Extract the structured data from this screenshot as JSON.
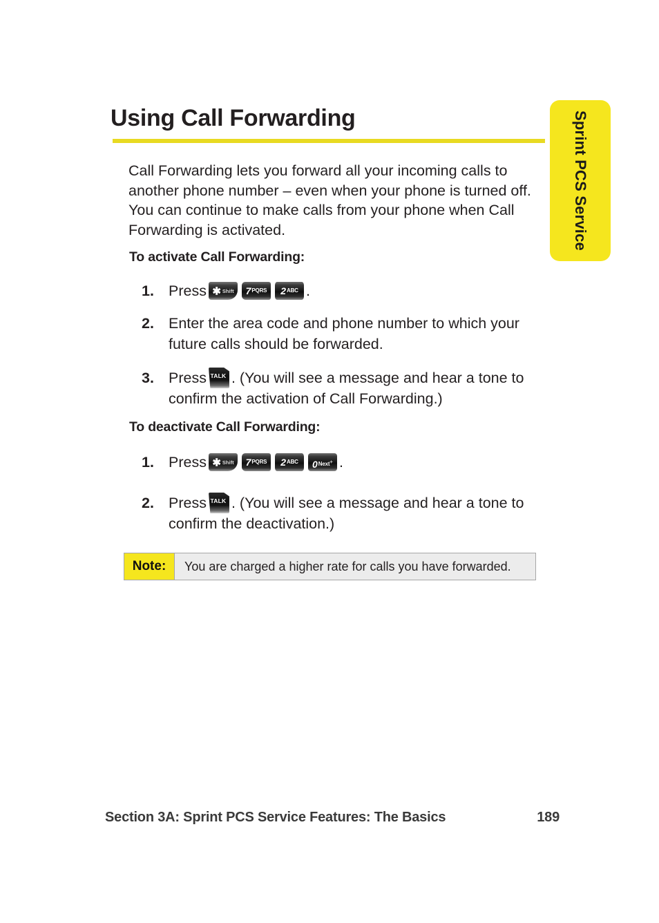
{
  "side_tab": {
    "label": "Sprint PCS Service",
    "color": "#F5E61E"
  },
  "heading": {
    "title": "Using Call Forwarding",
    "rule_color": "#E8DA22"
  },
  "intro": "Call Forwarding lets you forward all your incoming calls to another phone number – even when your phone is turned off. You can continue to make calls from your phone when Call Forwarding is activated.",
  "activate": {
    "subhead": "To activate Call Forwarding:",
    "steps": [
      {
        "num": "1.",
        "lead": "Press",
        "trail": ".",
        "keys": [
          {
            "icon": "key-star-shift",
            "big": "✱",
            "small": "Shift",
            "sup": ""
          },
          {
            "icon": "key-7-pqrs",
            "big": "7",
            "small": "PQRS",
            "sup": ""
          },
          {
            "icon": "key-2-abc",
            "big": "2",
            "small": "ABC",
            "sup": ""
          }
        ]
      },
      {
        "num": "2.",
        "lead": "Enter the area code and phone number to which your future calls should be forwarded.",
        "trail": "",
        "keys": []
      },
      {
        "num": "3.",
        "lead": "Press",
        "trail": ". (You will see a message and hear a tone to confirm the activation of Call Forwarding.)",
        "keys": [
          {
            "icon": "key-talk",
            "big": "TALK",
            "small": "",
            "sup": ""
          }
        ]
      }
    ]
  },
  "deactivate": {
    "subhead": "To deactivate Call Forwarding:",
    "steps": [
      {
        "num": "1.",
        "lead": "Press",
        "trail": ".",
        "keys": [
          {
            "icon": "key-star-shift",
            "big": "✱",
            "small": "Shift",
            "sup": ""
          },
          {
            "icon": "key-7-pqrs",
            "big": "7",
            "small": "PQRS",
            "sup": ""
          },
          {
            "icon": "key-2-abc",
            "big": "2",
            "small": "ABC",
            "sup": ""
          },
          {
            "icon": "key-0-next",
            "big": "0",
            "small": "Next",
            "sup": "+"
          }
        ]
      },
      {
        "num": "2.",
        "lead": "Press",
        "trail": ". (You will see a message and hear a tone to confirm the deactivation.)",
        "keys": [
          {
            "icon": "key-talk",
            "big": "TALK",
            "small": "",
            "sup": ""
          }
        ]
      }
    ]
  },
  "note": {
    "label": "Note:",
    "text": "You are charged a higher rate for calls you have forwarded.",
    "label_color": "#F5E61E",
    "body_color": "#ececec"
  },
  "footer": {
    "section": "Section 3A: Sprint PCS Service Features: The Basics",
    "page": "189"
  }
}
